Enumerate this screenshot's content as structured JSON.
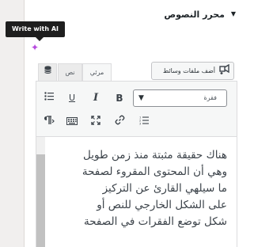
{
  "panel": {
    "title": "محرر النصوص",
    "caret": "▼"
  },
  "tooltip": {
    "label": "Write with AI"
  },
  "ai_icon": {
    "glyph": "✦"
  },
  "media_button": {
    "label": "أضف ملفات وسائط",
    "icon": "media-plus-icon"
  },
  "tabs": {
    "visual": "مرئي",
    "text": "نص"
  },
  "toolbar": {
    "format_value": "فقرة",
    "bold": "B",
    "italic": "I",
    "underline": "U",
    "icons": [
      "bulleted-list-icon",
      "numbered-list-icon",
      "link-icon",
      "fullscreen-icon",
      "keyboard-icon",
      "paragraph-direction-icon",
      "database-icon"
    ]
  },
  "editor": {
    "lines": [
      "هناك حقيقة مثبتة منذ زمن طويل",
      "وهي أن المحتوى المقروء لصفحة",
      "ما سيلهي القارئ عن التركيز",
      "على الشكل الخارجي للنص أو",
      "شكل توضع الفقرات في الصفحة"
    ]
  },
  "colors": {
    "accent_purple": "#b64ade",
    "text": "#3c434a"
  }
}
